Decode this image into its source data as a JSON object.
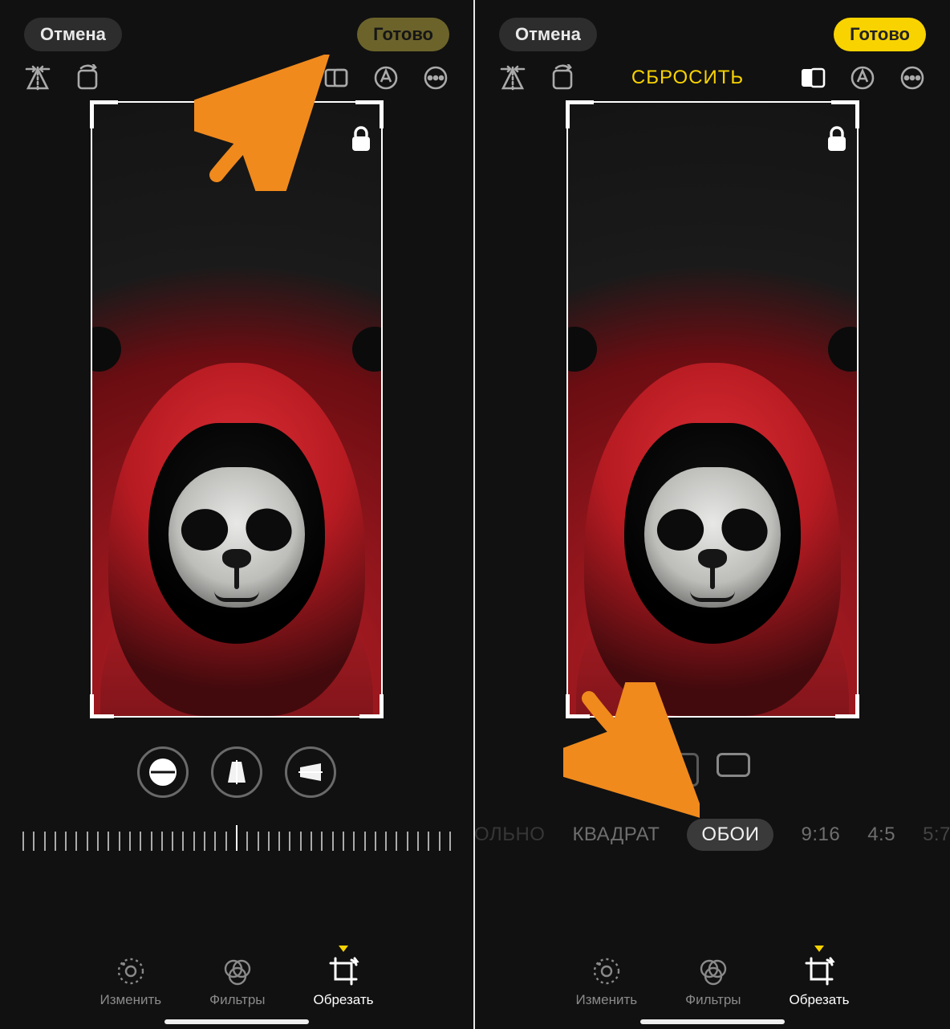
{
  "left": {
    "topbar": {
      "cancel": "Отмена",
      "done": "Готово"
    },
    "toolrow": {
      "reset": ""
    }
  },
  "right": {
    "topbar": {
      "cancel": "Отмена",
      "done": "Готово"
    },
    "toolrow": {
      "reset": "СБРОСИТЬ"
    },
    "aspects": {
      "free": "ОЛЬНО",
      "square": "КВАДРАТ",
      "wallpaper": "ОБОИ",
      "r_9_16": "9:16",
      "r_4_5": "4:5",
      "r_5_7": "5:7"
    }
  },
  "tabs": {
    "adjust": "Изменить",
    "filters": "Фильтры",
    "crop": "Обрезать"
  }
}
